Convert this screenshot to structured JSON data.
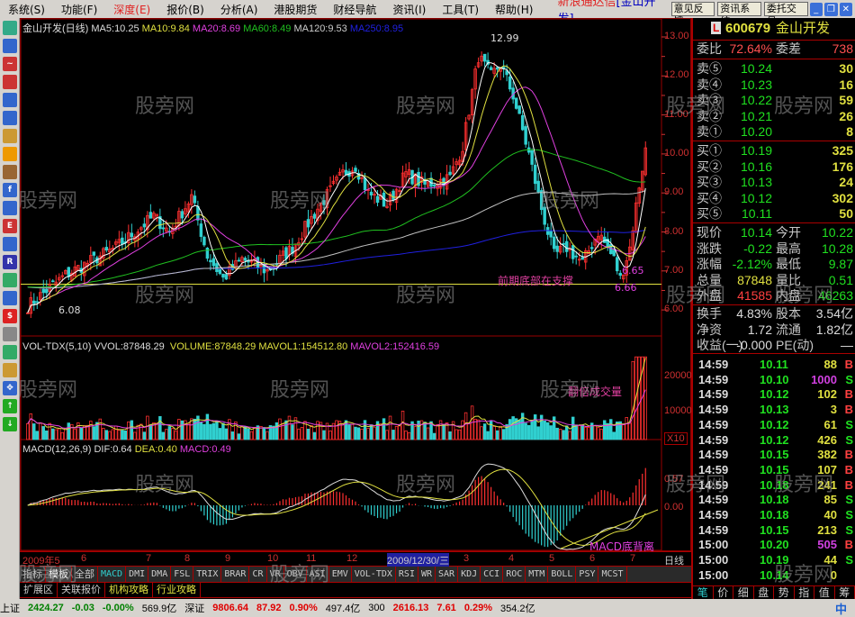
{
  "menu": [
    "系统(S)",
    "功能(F)",
    "深度(E)",
    "报价(B)",
    "分析(A)",
    "港股期货",
    "财经导航",
    "资讯(I)",
    "工具(T)",
    "帮助(H)"
  ],
  "app_title": "新浪通达信",
  "app_title_stock": "[金山开发]",
  "top_buttons": [
    "意见反馈",
    "资讯系统",
    "委托交易"
  ],
  "price_panel": {
    "title": "金山开发(日线)",
    "ma5": "MA5:10.25",
    "ma10": "MA10:9.84",
    "ma20": "MA20:8.69",
    "ma60": "MA60:8.49",
    "ma120": "MA120:9.53",
    "ma250": "MA250:8.95",
    "axis": [
      "13.00",
      "12.00",
      "11.00",
      "10.00",
      "9.00",
      "8.00",
      "7.00",
      "6.00"
    ],
    "high_label": "12.99",
    "low_label": "6.08",
    "low2_label": "6.66",
    "low3_label": "6.65",
    "support_note": "前期底部在支撑"
  },
  "volume_panel": {
    "title": "VOL-TDX(5,10)",
    "vvol": "VVOL:87848.29",
    "volume": "VOLUME:87848.29",
    "mavol1": "MAVOL1:154512.80",
    "mavol2": "MAVOL2:152416.59",
    "axis": [
      "20000",
      "10000"
    ],
    "unit": "X10",
    "note": "翻倍成交量"
  },
  "macd_panel": {
    "title": "MACD(12,26,9)",
    "dif": "DIF:0.64",
    "dea": "DEA:0.40",
    "macd": "MACD:0.49",
    "axis": [
      "0.57",
      "0.00"
    ],
    "note": "MACD底背离"
  },
  "dates": [
    "2009年5",
    "6",
    "7",
    "8",
    "9",
    "10",
    "11",
    "12",
    "2009/12/30/三",
    "3",
    "4",
    "5",
    "6",
    "7",
    "日线"
  ],
  "indicator_tabs": [
    "指标",
    "模板",
    "全部",
    "MACD",
    "DMI",
    "DMA",
    "FSL",
    "TRIX",
    "BRAR",
    "CR",
    "VR",
    "OBV",
    "ASI",
    "EMV",
    "VOL-TDX",
    "RSI",
    "WR",
    "SAR",
    "KDJ",
    "CCI",
    "ROC",
    "MTM",
    "BOLL",
    "PSY",
    "MCST"
  ],
  "ext_tabs": [
    "扩展区",
    "关联报价",
    "机构攻略",
    "行业攻略"
  ],
  "status": {
    "sh_name": "上证",
    "sh_val": "2424.27",
    "sh_chg": "-0.03",
    "sh_pct": "-0.00%",
    "sh_amt": "569.9亿",
    "sz_name": "深证",
    "sz_val": "9806.64",
    "sz_chg": "87.92",
    "sz_pct": "0.90%",
    "sz_amt": "497.4亿",
    "hs_name": "300",
    "hs_val": "2616.13",
    "hs_chg": "7.61",
    "hs_pct": "0.29%",
    "hs_amt": "354.2亿",
    "ime": "中"
  },
  "quote": {
    "badge": "L",
    "code": "600679",
    "name": "金山开发",
    "wb_label": "委比",
    "wb": "72.64%",
    "wc_label": "委差",
    "wc": "738",
    "sells": [
      {
        "l": "卖⑤",
        "p": "10.24",
        "v": "30"
      },
      {
        "l": "卖④",
        "p": "10.23",
        "v": "16"
      },
      {
        "l": "卖③",
        "p": "10.22",
        "v": "59"
      },
      {
        "l": "卖②",
        "p": "10.21",
        "v": "26"
      },
      {
        "l": "卖①",
        "p": "10.20",
        "v": "8"
      }
    ],
    "buys": [
      {
        "l": "买①",
        "p": "10.19",
        "v": "325"
      },
      {
        "l": "买②",
        "p": "10.16",
        "v": "176"
      },
      {
        "l": "买③",
        "p": "10.13",
        "v": "24"
      },
      {
        "l": "买④",
        "p": "10.12",
        "v": "302"
      },
      {
        "l": "买⑤",
        "p": "10.11",
        "v": "50"
      }
    ],
    "stats": [
      {
        "l1": "现价",
        "v1": "10.14",
        "c1": "#20e020",
        "l2": "今开",
        "v2": "10.22",
        "c2": "#20e020"
      },
      {
        "l1": "涨跌",
        "v1": "-0.22",
        "c1": "#20e020",
        "l2": "最高",
        "v2": "10.28",
        "c2": "#20e020"
      },
      {
        "l1": "涨幅",
        "v1": "-2.12%",
        "c1": "#20e020",
        "l2": "最低",
        "v2": "9.87",
        "c2": "#20e020"
      },
      {
        "l1": "总量",
        "v1": "87848",
        "c1": "#e0e040",
        "l2": "量比",
        "v2": "0.51",
        "c2": "#20e020"
      },
      {
        "l1": "外盘",
        "v1": "41585",
        "c1": "#ff4040",
        "l2": "内盘",
        "v2": "46263",
        "c2": "#20e020"
      }
    ],
    "fund": [
      {
        "l1": "换手",
        "v1": "4.83%",
        "l2": "股本",
        "v2": "3.54亿"
      },
      {
        "l1": "净资",
        "v1": "1.72",
        "l2": "流通",
        "v2": "1.82亿"
      },
      {
        "l1": "收益(一)",
        "v1": "-0.000",
        "l2": "PE(动)",
        "v2": "—"
      }
    ],
    "trades": [
      [
        "14:59",
        "10.11",
        "88",
        "B"
      ],
      [
        "14:59",
        "10.10",
        "1000",
        "S"
      ],
      [
        "14:59",
        "10.12",
        "102",
        "B"
      ],
      [
        "14:59",
        "10.13",
        "3",
        "B"
      ],
      [
        "14:59",
        "10.12",
        "61",
        "S"
      ],
      [
        "14:59",
        "10.12",
        "426",
        "S"
      ],
      [
        "14:59",
        "10.15",
        "382",
        "B"
      ],
      [
        "14:59",
        "10.15",
        "107",
        "B"
      ],
      [
        "14:59",
        "10.18",
        "241",
        "B"
      ],
      [
        "14:59",
        "10.18",
        "85",
        "S"
      ],
      [
        "14:59",
        "10.18",
        "40",
        "S"
      ],
      [
        "14:59",
        "10.15",
        "213",
        "S"
      ],
      [
        "15:00",
        "10.20",
        "505",
        "B"
      ],
      [
        "15:00",
        "10.19",
        "44",
        "S"
      ],
      [
        "15:00",
        "10.14",
        "0",
        ""
      ]
    ],
    "tabs": [
      "笔",
      "价",
      "细",
      "盘",
      "势",
      "指",
      "值",
      "筹"
    ]
  },
  "watermark": "股旁网",
  "colors": {
    "up": "#ff3030",
    "down": "#30d0d0",
    "ma5": "#ffffff",
    "ma10": "#e0e040",
    "ma20": "#e040e0",
    "ma60": "#20c020",
    "ma120": "#c0c0c0",
    "ma250": "#2020e0"
  },
  "chart_data": {
    "type": "candlestick",
    "days": 170,
    "keypoints": [
      [
        0,
        6.1
      ],
      [
        12,
        6.9
      ],
      [
        28,
        7.6
      ],
      [
        40,
        8.4
      ],
      [
        45,
        8.0
      ],
      [
        52,
        8.9
      ],
      [
        57,
        7.4
      ],
      [
        62,
        6.8
      ],
      [
        68,
        7.3
      ],
      [
        76,
        7.0
      ],
      [
        84,
        7.6
      ],
      [
        92,
        8.6
      ],
      [
        100,
        9.5
      ],
      [
        104,
        9.7
      ],
      [
        108,
        9.0
      ],
      [
        114,
        8.7
      ],
      [
        120,
        9.5
      ],
      [
        126,
        9.2
      ],
      [
        134,
        9.4
      ],
      [
        138,
        10.2
      ],
      [
        143,
        12.5
      ],
      [
        147,
        12.0
      ],
      [
        150,
        12.3
      ],
      [
        154,
        11.5
      ],
      [
        159,
        10.0
      ],
      [
        163,
        8.6
      ],
      [
        167,
        7.4
      ],
      [
        171,
        7.6
      ],
      [
        176,
        7.2
      ],
      [
        181,
        8.0
      ],
      [
        186,
        7.3
      ],
      [
        188,
        6.8
      ],
      [
        191,
        7.6
      ],
      [
        194,
        9.2
      ],
      [
        196,
        10.1
      ]
    ]
  }
}
